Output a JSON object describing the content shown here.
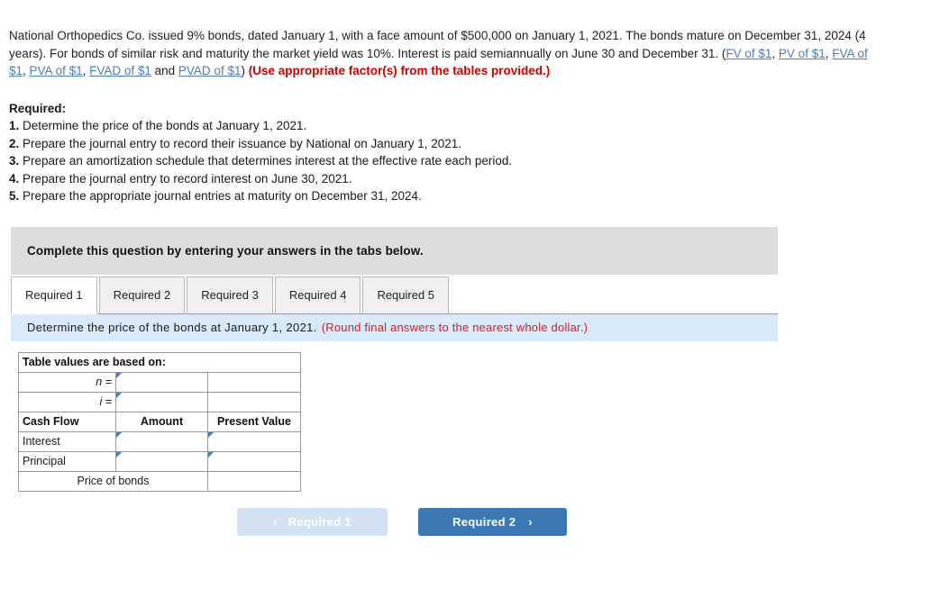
{
  "problem": {
    "segments": [
      {
        "type": "text",
        "value": "National Orthopedics Co. issued 9% bonds, dated January 1, with a face amount of $500,000 on January 1, 2021. The bonds mature on December 31, 2024 (4 years). For bonds of similar risk and maturity the market yield was 10%. Interest is paid semiannually on June 30 and December 31. ("
      },
      {
        "type": "link",
        "value": "FV of $1"
      },
      {
        "type": "text",
        "value": ", "
      },
      {
        "type": "link",
        "value": "PV of $1"
      },
      {
        "type": "text",
        "value": ", "
      },
      {
        "type": "link",
        "value": "FVA of $1"
      },
      {
        "type": "text",
        "value": ", "
      },
      {
        "type": "link",
        "value": "PVA of $1"
      },
      {
        "type": "text",
        "value": ", "
      },
      {
        "type": "link",
        "value": "FVAD of $1"
      },
      {
        "type": "text",
        "value": " and "
      },
      {
        "type": "link",
        "value": "PVAD of $1"
      },
      {
        "type": "text",
        "value": ") "
      },
      {
        "type": "red",
        "value": "(Use appropriate factor(s) from the tables provided.)"
      }
    ],
    "link_labels": [
      "FV of $1",
      "PV of $1",
      "FVA of $1",
      "PVA of $1",
      "FVAD of $1",
      "PVAD of $1"
    ],
    "red_note": "(Use appropriate factor(s) from the tables provided.)"
  },
  "required": {
    "title": "Required:",
    "items": [
      {
        "num": "1.",
        "text": "Determine the price of the bonds at January 1, 2021."
      },
      {
        "num": "2.",
        "text": "Prepare the journal entry to record their issuance by National on January 1, 2021."
      },
      {
        "num": "3.",
        "text": "Prepare an amortization schedule that determines interest at the effective rate each period."
      },
      {
        "num": "4.",
        "text": "Prepare the journal entry to record interest on June 30, 2021."
      },
      {
        "num": "5.",
        "text": "Prepare the appropriate journal entries at maturity on December 31, 2024."
      }
    ]
  },
  "banner": {
    "text": "Complete this question by entering your answers in the tabs below."
  },
  "tabs": [
    {
      "label": "Required 1",
      "active": true
    },
    {
      "label": "Required 2",
      "active": false
    },
    {
      "label": "Required 3",
      "active": false
    },
    {
      "label": "Required 4",
      "active": false
    },
    {
      "label": "Required 5",
      "active": false
    }
  ],
  "instruction": {
    "text": "Determine the price of the bonds at January 1, 2021.",
    "note": "(Round final answers to the nearest whole dollar.)"
  },
  "answer_table": {
    "title": "Table values are based on:",
    "n_label": "n =",
    "n_value": "",
    "i_label": "i =",
    "i_value": "",
    "columns": [
      "Cash Flow",
      "Amount",
      "Present Value"
    ],
    "rows": [
      {
        "label": "Interest",
        "amount": "",
        "present_value": ""
      },
      {
        "label": "Principal",
        "amount": "",
        "present_value": ""
      }
    ],
    "total_label": "Price of bonds",
    "total_value": ""
  },
  "nav": {
    "prev_label": "Required 1",
    "prev_chevron": "‹",
    "next_label": "Required 2",
    "next_chevron": "›"
  },
  "colors": {
    "header_blue": "#7ca6d8",
    "instruction_blue": "#d8eafa",
    "banner_gray": "#dddddd",
    "link_blue": "#4a7ebb",
    "red": "#cc0000",
    "note_red": "#cc2229",
    "yellow_cell": "#ffffc0",
    "button_active": "#3c78b4",
    "button_disabled": "#d3e2f2"
  }
}
